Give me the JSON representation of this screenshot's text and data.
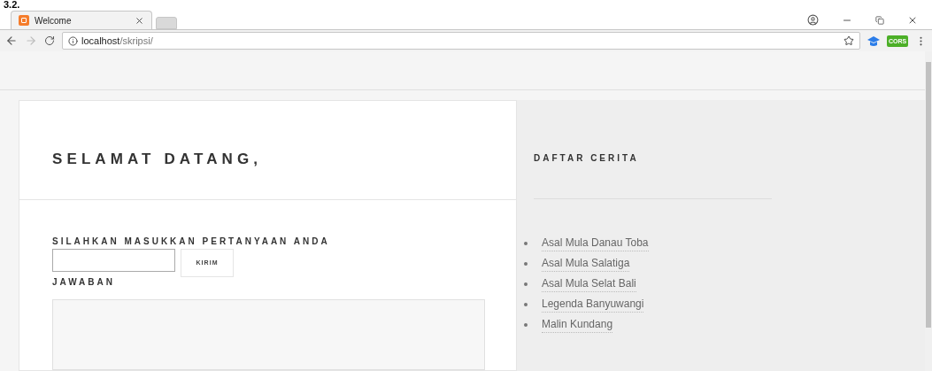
{
  "caption": "3.2.",
  "browser": {
    "tab": {
      "title": "Welcome"
    },
    "url": {
      "host": "localhost",
      "path": "/skripsi/"
    },
    "extension_badge": "CORS"
  },
  "main": {
    "heading": "SELAMAT DATANG,",
    "question_label": "SILAHKAN MASUKKAN PERTANYAAN ANDA",
    "submit_button": "KIRIM",
    "answer_label": "JAWABAN"
  },
  "sidebar": {
    "heading": "DAFTAR CERITA",
    "stories": [
      "Asal Mula Danau Toba",
      "Asal Mula Salatiga",
      "Asal Mula Selat Bali",
      "Legenda Banyuwangi",
      "Malin Kundang"
    ]
  }
}
